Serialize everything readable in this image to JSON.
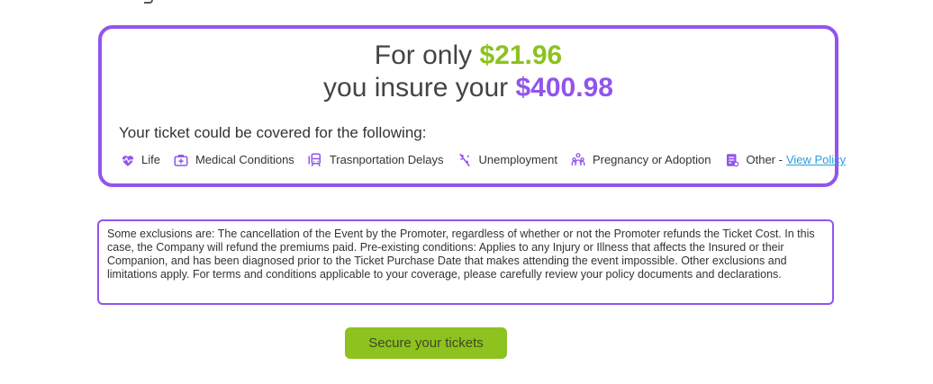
{
  "offer": {
    "line1_prefix": "For only ",
    "premium": "$21.96",
    "line2_prefix": "you insure your ",
    "ticket_value": "$400.98"
  },
  "coverage": {
    "intro": "Your ticket could be covered for the following:",
    "items": [
      {
        "label": "Life",
        "icon": "heart-pulse-icon"
      },
      {
        "label": "Medical Conditions",
        "icon": "medical-kit-icon"
      },
      {
        "label": "Trasnportation Delays",
        "icon": "transport-icon"
      },
      {
        "label": "Unemployment",
        "icon": "unemployment-icon"
      },
      {
        "label": "Pregnancy or Adoption",
        "icon": "family-icon"
      },
      {
        "label": "Other - ",
        "icon": "policy-document-icon"
      }
    ],
    "view_policy": "View Policy"
  },
  "exclusions": {
    "text": "Some exclusions are: The cancellation of the Event by the Promoter, regardless of whether or not the Promoter refunds the Ticket Cost. In this case, the Company will refund the premiums paid. Pre-existing conditions: Applies to any Injury or Illness that affects the Insured or their Companion, and has been diagnosed prior to the Ticket Purchase Date that makes attending the event impossible. Other exclusions and limitations apply. For terms and conditions applicable to your coverage, please carefully review your policy documents and declarations."
  },
  "cta": {
    "label": "Secure your tickets"
  },
  "colors": {
    "accent_purple": "#9155ec",
    "accent_green": "#8dc21f",
    "link_blue": "#2a9de0"
  }
}
